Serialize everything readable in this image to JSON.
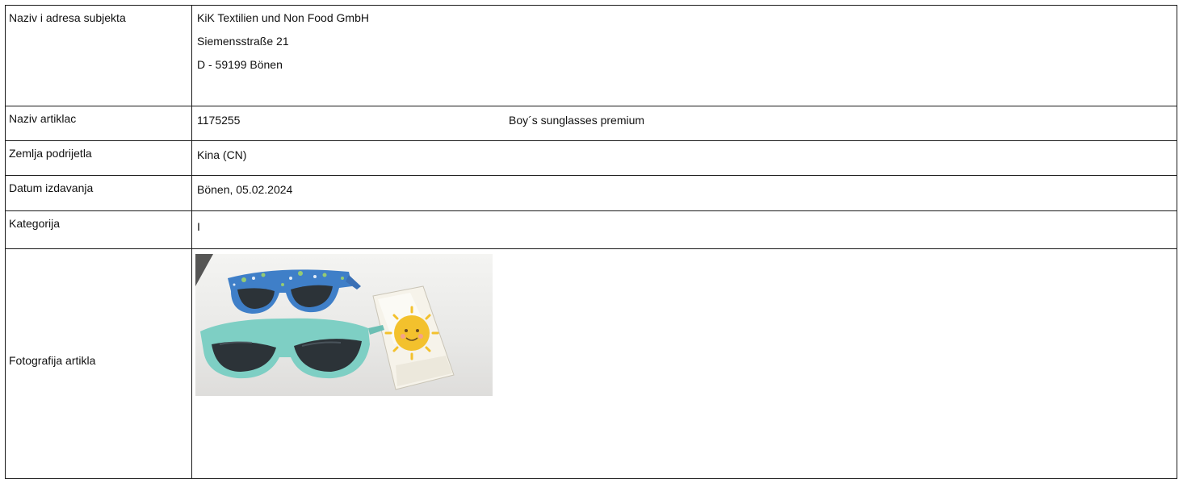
{
  "rows": {
    "subject": {
      "label": "Naziv i adresa subjekta",
      "lines": [
        "KiK Textilien und Non Food GmbH",
        "Siemensstraße 21",
        "D - 59199 Bönen"
      ]
    },
    "article": {
      "label": "Naziv artiklac",
      "number": "1175255",
      "name": "Boy´s sunglasses premium"
    },
    "origin": {
      "label": "Zemlja podrijetla",
      "value": "Kina (CN)"
    },
    "date": {
      "label": "Datum izdavanja",
      "value": "Bönen, 05.02.2024"
    },
    "category": {
      "label": "Kategorija",
      "value": "I"
    },
    "photo": {
      "label": "Fotografija artikla",
      "image_subject": "photo-of-two-sunglasses-and-sun-card"
    }
  },
  "colors": {
    "border": "#1a1a1a",
    "frame_blue": "#3f7fc8",
    "frame_turquoise": "#7ecfc4",
    "lens_dark": "#2c3338",
    "card_yellow": "#f3c12d"
  }
}
